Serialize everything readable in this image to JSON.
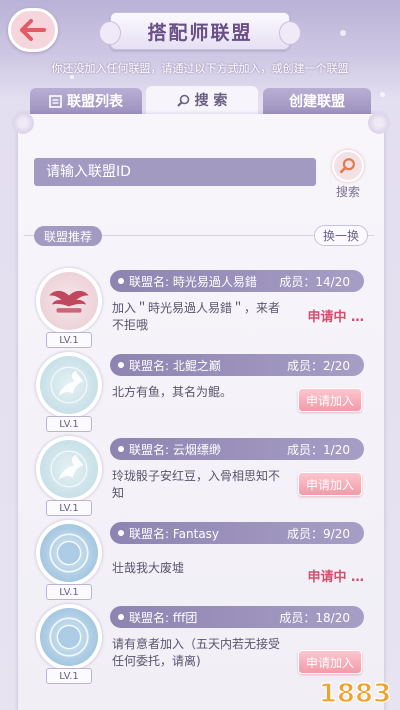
{
  "header": {
    "title": "搭配师联盟",
    "notice": "你还没加入任何联盟，请通过以下方式加入，或创建一个联盟"
  },
  "tabs": {
    "list_label": "联盟列表",
    "search_label": "搜 索",
    "create_label": "创建联盟"
  },
  "search": {
    "placeholder": "请输入联盟ID",
    "button_label": "搜索"
  },
  "recommend": {
    "section_label": "联盟推荐",
    "refresh_label": "换一换"
  },
  "alliances": [
    {
      "name": "联盟名: 時光易過人易錯",
      "members": "成员：14/20",
      "motto": "加入＂時光易過人易錯＂，来者不拒哦",
      "level": "LV.1",
      "action": "申请中 …",
      "emblem": "winged-crest-emblem"
    },
    {
      "name": "联盟名: 北鲲之巅",
      "members": "成员：2/20",
      "motto": "北方有鱼，其名为鲲。",
      "level": "LV.1",
      "action": "申请加入",
      "emblem": "phoenix-emblem"
    },
    {
      "name": "联盟名: 云烟缥缈",
      "members": "成员：1/20",
      "motto": "玲珑骰子安红豆，入骨相思知不知",
      "level": "LV.1",
      "action": "申请加入",
      "emblem": "phoenix-emblem"
    },
    {
      "name": "联盟名: Fantasy",
      "members": "成员：9/20",
      "motto": "壮哉我大废墟",
      "level": "LV.1",
      "action": "申请中 …",
      "emblem": "blue-default-emblem"
    },
    {
      "name": "联盟名: fff团",
      "members": "成员：18/20",
      "motto": "请有意者加入（五天内若无接受任何委托，请离)",
      "level": "LV.1",
      "action": "申请加入",
      "emblem": "blue-default-emblem"
    }
  ],
  "watermark": "1883",
  "colors": {
    "accent_purple": "#a39ac1",
    "apply_pink": "#f39aa8",
    "applying_red": "#d24f6e"
  }
}
